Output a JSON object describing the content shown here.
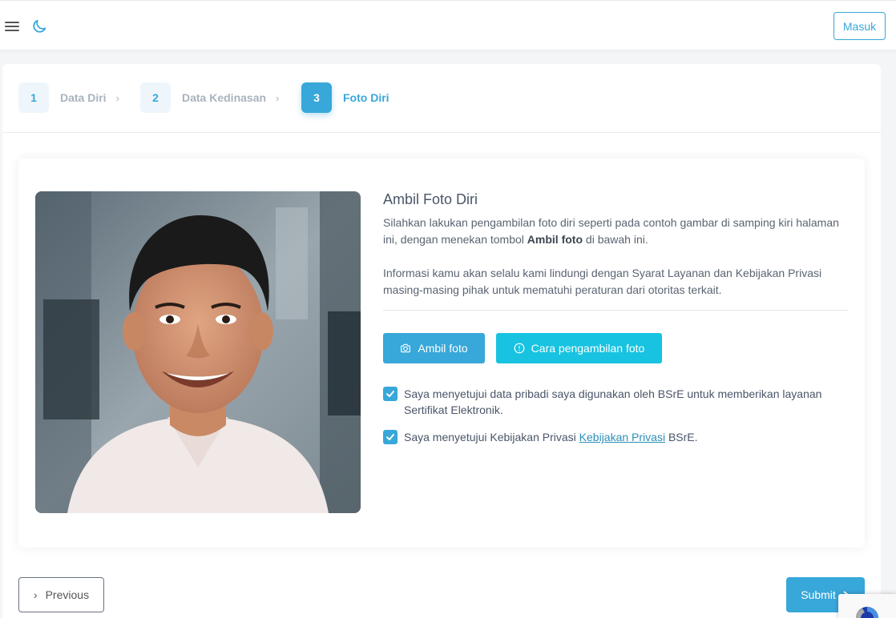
{
  "header": {
    "login_label": "Masuk"
  },
  "stepper": {
    "steps": [
      {
        "number": "1",
        "label": "Data Diri",
        "separator": "›"
      },
      {
        "number": "2",
        "label": "Data Kedinasan",
        "separator": "›"
      },
      {
        "number": "3",
        "label": "Foto Diri"
      }
    ]
  },
  "photo_section": {
    "title": "Ambil Foto Diri",
    "description_part1": "Silahkan lakukan pengambilan foto diri seperti pada contoh gambar di samping kiri halaman ini, dengan menekan tombol ",
    "description_bold": "Ambil foto",
    "description_part2": " di bawah ini.",
    "privacy_info": "Informasi kamu akan selalu kami lindungi dengan Syarat Layanan dan Kebijakan Privasi masing-masing pihak untuk mematuhi peraturan dari otoritas terkait.",
    "take_photo_button": "Ambil foto",
    "how_to_button": "Cara pengambilan foto"
  },
  "consents": {
    "consent1": "Saya menyetujui data pribadi saya digunakan oleh BSrE untuk memberikan layanan Sertifikat Elektronik.",
    "consent2_prefix": "Saya menyetujui Kebijakan Privasi ",
    "consent2_link": "Kebijakan Privasi",
    "consent2_suffix": " BSrE."
  },
  "footer": {
    "previous_label": "Previous",
    "previous_chevron": "›",
    "submit_label": "Submit"
  },
  "colors": {
    "accent": "#38a7d9",
    "accent_cyan": "#17c3e0",
    "step_inactive_bg": "#eef6fb"
  }
}
